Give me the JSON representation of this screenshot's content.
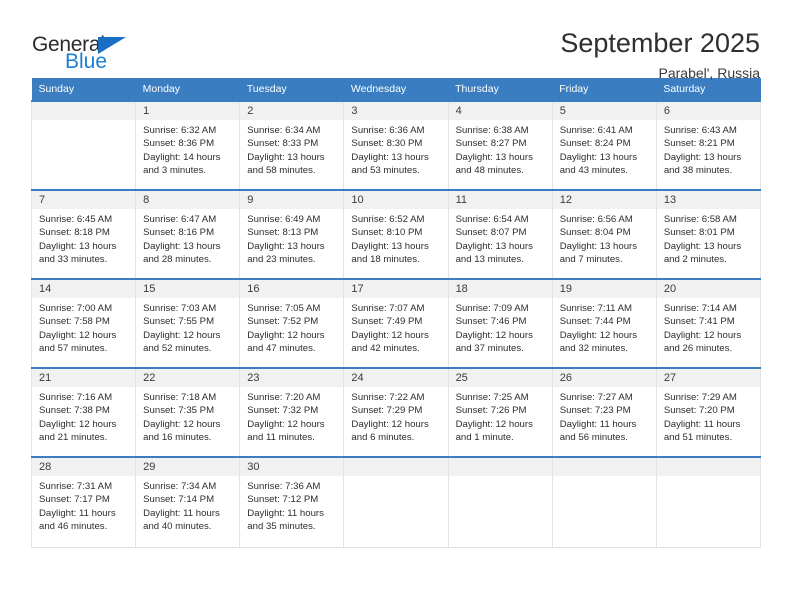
{
  "logo": {
    "text_general": "General",
    "text_blue": "Blue",
    "triangle_color": "#1a6fc4",
    "blue_color": "#1a7fd4"
  },
  "header": {
    "title": "September 2025",
    "subtitle": "Parabel', Russia"
  },
  "theme": {
    "header_row_bg": "#3a7ec1",
    "daynum_band_bg": "#f1f1f1",
    "cell_border": "#e3e3e3",
    "week_top_border": "#3a7ec1"
  },
  "weekday_headers": [
    "Sunday",
    "Monday",
    "Tuesday",
    "Wednesday",
    "Thursday",
    "Friday",
    "Saturday"
  ],
  "labels": {
    "sunrise_prefix": "Sunrise:",
    "sunset_prefix": "Sunset:",
    "daylight_prefix": "Daylight:"
  },
  "weeks": [
    [
      {
        "day": "",
        "l1": "",
        "l2": "",
        "l3": "",
        "l4": ""
      },
      {
        "day": "1",
        "l1": "Sunrise: 6:32 AM",
        "l2": "Sunset: 8:36 PM",
        "l3": "Daylight: 14 hours",
        "l4": "and 3 minutes."
      },
      {
        "day": "2",
        "l1": "Sunrise: 6:34 AM",
        "l2": "Sunset: 8:33 PM",
        "l3": "Daylight: 13 hours",
        "l4": "and 58 minutes."
      },
      {
        "day": "3",
        "l1": "Sunrise: 6:36 AM",
        "l2": "Sunset: 8:30 PM",
        "l3": "Daylight: 13 hours",
        "l4": "and 53 minutes."
      },
      {
        "day": "4",
        "l1": "Sunrise: 6:38 AM",
        "l2": "Sunset: 8:27 PM",
        "l3": "Daylight: 13 hours",
        "l4": "and 48 minutes."
      },
      {
        "day": "5",
        "l1": "Sunrise: 6:41 AM",
        "l2": "Sunset: 8:24 PM",
        "l3": "Daylight: 13 hours",
        "l4": "and 43 minutes."
      },
      {
        "day": "6",
        "l1": "Sunrise: 6:43 AM",
        "l2": "Sunset: 8:21 PM",
        "l3": "Daylight: 13 hours",
        "l4": "and 38 minutes."
      }
    ],
    [
      {
        "day": "7",
        "l1": "Sunrise: 6:45 AM",
        "l2": "Sunset: 8:18 PM",
        "l3": "Daylight: 13 hours",
        "l4": "and 33 minutes."
      },
      {
        "day": "8",
        "l1": "Sunrise: 6:47 AM",
        "l2": "Sunset: 8:16 PM",
        "l3": "Daylight: 13 hours",
        "l4": "and 28 minutes."
      },
      {
        "day": "9",
        "l1": "Sunrise: 6:49 AM",
        "l2": "Sunset: 8:13 PM",
        "l3": "Daylight: 13 hours",
        "l4": "and 23 minutes."
      },
      {
        "day": "10",
        "l1": "Sunrise: 6:52 AM",
        "l2": "Sunset: 8:10 PM",
        "l3": "Daylight: 13 hours",
        "l4": "and 18 minutes."
      },
      {
        "day": "11",
        "l1": "Sunrise: 6:54 AM",
        "l2": "Sunset: 8:07 PM",
        "l3": "Daylight: 13 hours",
        "l4": "and 13 minutes."
      },
      {
        "day": "12",
        "l1": "Sunrise: 6:56 AM",
        "l2": "Sunset: 8:04 PM",
        "l3": "Daylight: 13 hours",
        "l4": "and 7 minutes."
      },
      {
        "day": "13",
        "l1": "Sunrise: 6:58 AM",
        "l2": "Sunset: 8:01 PM",
        "l3": "Daylight: 13 hours",
        "l4": "and 2 minutes."
      }
    ],
    [
      {
        "day": "14",
        "l1": "Sunrise: 7:00 AM",
        "l2": "Sunset: 7:58 PM",
        "l3": "Daylight: 12 hours",
        "l4": "and 57 minutes."
      },
      {
        "day": "15",
        "l1": "Sunrise: 7:03 AM",
        "l2": "Sunset: 7:55 PM",
        "l3": "Daylight: 12 hours",
        "l4": "and 52 minutes."
      },
      {
        "day": "16",
        "l1": "Sunrise: 7:05 AM",
        "l2": "Sunset: 7:52 PM",
        "l3": "Daylight: 12 hours",
        "l4": "and 47 minutes."
      },
      {
        "day": "17",
        "l1": "Sunrise: 7:07 AM",
        "l2": "Sunset: 7:49 PM",
        "l3": "Daylight: 12 hours",
        "l4": "and 42 minutes."
      },
      {
        "day": "18",
        "l1": "Sunrise: 7:09 AM",
        "l2": "Sunset: 7:46 PM",
        "l3": "Daylight: 12 hours",
        "l4": "and 37 minutes."
      },
      {
        "day": "19",
        "l1": "Sunrise: 7:11 AM",
        "l2": "Sunset: 7:44 PM",
        "l3": "Daylight: 12 hours",
        "l4": "and 32 minutes."
      },
      {
        "day": "20",
        "l1": "Sunrise: 7:14 AM",
        "l2": "Sunset: 7:41 PM",
        "l3": "Daylight: 12 hours",
        "l4": "and 26 minutes."
      }
    ],
    [
      {
        "day": "21",
        "l1": "Sunrise: 7:16 AM",
        "l2": "Sunset: 7:38 PM",
        "l3": "Daylight: 12 hours",
        "l4": "and 21 minutes."
      },
      {
        "day": "22",
        "l1": "Sunrise: 7:18 AM",
        "l2": "Sunset: 7:35 PM",
        "l3": "Daylight: 12 hours",
        "l4": "and 16 minutes."
      },
      {
        "day": "23",
        "l1": "Sunrise: 7:20 AM",
        "l2": "Sunset: 7:32 PM",
        "l3": "Daylight: 12 hours",
        "l4": "and 11 minutes."
      },
      {
        "day": "24",
        "l1": "Sunrise: 7:22 AM",
        "l2": "Sunset: 7:29 PM",
        "l3": "Daylight: 12 hours",
        "l4": "and 6 minutes."
      },
      {
        "day": "25",
        "l1": "Sunrise: 7:25 AM",
        "l2": "Sunset: 7:26 PM",
        "l3": "Daylight: 12 hours",
        "l4": "and 1 minute."
      },
      {
        "day": "26",
        "l1": "Sunrise: 7:27 AM",
        "l2": "Sunset: 7:23 PM",
        "l3": "Daylight: 11 hours",
        "l4": "and 56 minutes."
      },
      {
        "day": "27",
        "l1": "Sunrise: 7:29 AM",
        "l2": "Sunset: 7:20 PM",
        "l3": "Daylight: 11 hours",
        "l4": "and 51 minutes."
      }
    ],
    [
      {
        "day": "28",
        "l1": "Sunrise: 7:31 AM",
        "l2": "Sunset: 7:17 PM",
        "l3": "Daylight: 11 hours",
        "l4": "and 46 minutes."
      },
      {
        "day": "29",
        "l1": "Sunrise: 7:34 AM",
        "l2": "Sunset: 7:14 PM",
        "l3": "Daylight: 11 hours",
        "l4": "and 40 minutes."
      },
      {
        "day": "30",
        "l1": "Sunrise: 7:36 AM",
        "l2": "Sunset: 7:12 PM",
        "l3": "Daylight: 11 hours",
        "l4": "and 35 minutes."
      },
      {
        "day": "",
        "l1": "",
        "l2": "",
        "l3": "",
        "l4": ""
      },
      {
        "day": "",
        "l1": "",
        "l2": "",
        "l3": "",
        "l4": ""
      },
      {
        "day": "",
        "l1": "",
        "l2": "",
        "l3": "",
        "l4": ""
      },
      {
        "day": "",
        "l1": "",
        "l2": "",
        "l3": "",
        "l4": ""
      }
    ]
  ]
}
